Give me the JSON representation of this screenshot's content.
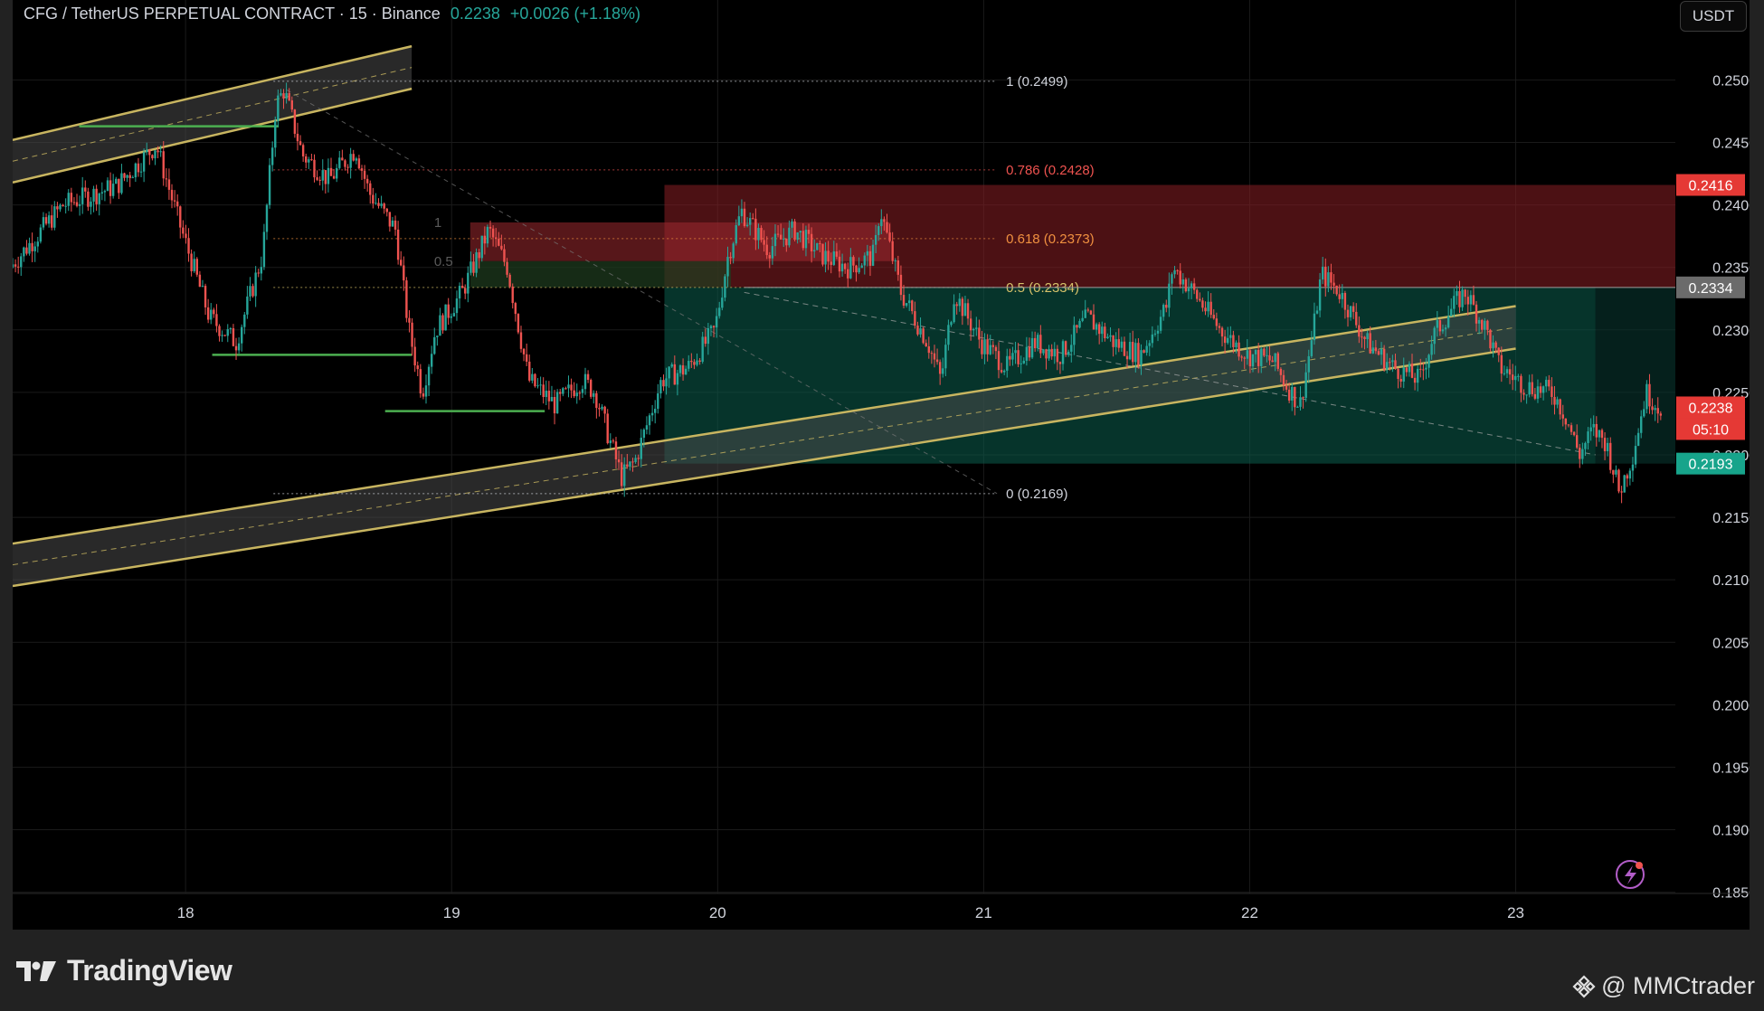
{
  "header": {
    "symbol": "CFG / TetherUS PERPETUAL CONTRACT · 15 · Binance",
    "price": "0.2238",
    "change": "+0.0026 (+1.18%)"
  },
  "currency_button": "USDT",
  "footer": {
    "brand": "TradingView",
    "watermark": "@ MMCtrader"
  },
  "colors": {
    "up": "#26a69a",
    "down": "#ef5350",
    "channel": "#c8b560",
    "fib": "#f0c060"
  },
  "chart_data": {
    "type": "candlestick",
    "title": "CFG / TetherUS PERPETUAL CONTRACT · 15 · Binance",
    "x_axis": {
      "labels": [
        "18",
        "19",
        "20",
        "21",
        "22",
        "23"
      ],
      "range": [
        17.35,
        23.6
      ]
    },
    "y_axis": {
      "range": [
        0.1849,
        0.2564
      ],
      "ticks": [
        "0.2500",
        "0.2450",
        "0.2400",
        "0.2350",
        "0.2300",
        "0.2250",
        "0.2200",
        "0.2150",
        "0.2100",
        "0.2050",
        "0.2000",
        "0.1950",
        "0.1900",
        "0.1850"
      ],
      "side": "right"
    },
    "price_path": [
      [
        17.35,
        0.235
      ],
      [
        17.55,
        0.24
      ],
      [
        17.75,
        0.2415
      ],
      [
        17.9,
        0.2448
      ],
      [
        17.98,
        0.239
      ],
      [
        18.1,
        0.231
      ],
      [
        18.2,
        0.229
      ],
      [
        18.3,
        0.236
      ],
      [
        18.35,
        0.248
      ],
      [
        18.38,
        0.2492
      ],
      [
        18.45,
        0.244
      ],
      [
        18.55,
        0.242
      ],
      [
        18.65,
        0.2445
      ],
      [
        18.7,
        0.241
      ],
      [
        18.8,
        0.238
      ],
      [
        18.85,
        0.23
      ],
      [
        18.9,
        0.225
      ],
      [
        18.95,
        0.23
      ],
      [
        19.05,
        0.233
      ],
      [
        19.15,
        0.238
      ],
      [
        19.22,
        0.235
      ],
      [
        19.3,
        0.226
      ],
      [
        19.4,
        0.224
      ],
      [
        19.5,
        0.226
      ],
      [
        19.55,
        0.225
      ],
      [
        19.6,
        0.2215
      ],
      [
        19.65,
        0.2182
      ],
      [
        19.7,
        0.2195
      ],
      [
        19.8,
        0.226
      ],
      [
        19.9,
        0.227
      ],
      [
        20.0,
        0.23
      ],
      [
        20.05,
        0.236
      ],
      [
        20.1,
        0.2395
      ],
      [
        20.2,
        0.2365
      ],
      [
        20.3,
        0.238
      ],
      [
        20.4,
        0.236
      ],
      [
        20.5,
        0.235
      ],
      [
        20.6,
        0.236
      ],
      [
        20.62,
        0.2398
      ],
      [
        20.7,
        0.233
      ],
      [
        20.8,
        0.229
      ],
      [
        20.85,
        0.226
      ],
      [
        20.9,
        0.233
      ],
      [
        21.0,
        0.229
      ],
      [
        21.1,
        0.227
      ],
      [
        21.2,
        0.229
      ],
      [
        21.3,
        0.228
      ],
      [
        21.4,
        0.231
      ],
      [
        21.5,
        0.229
      ],
      [
        21.6,
        0.228
      ],
      [
        21.7,
        0.232
      ],
      [
        21.72,
        0.235
      ],
      [
        21.8,
        0.233
      ],
      [
        21.9,
        0.23
      ],
      [
        22.0,
        0.228
      ],
      [
        22.1,
        0.2275
      ],
      [
        22.15,
        0.2255
      ],
      [
        22.2,
        0.224
      ],
      [
        22.25,
        0.23
      ],
      [
        22.28,
        0.2345
      ],
      [
        22.35,
        0.233
      ],
      [
        22.45,
        0.229
      ],
      [
        22.55,
        0.227
      ],
      [
        22.65,
        0.226
      ],
      [
        22.7,
        0.2295
      ],
      [
        22.78,
        0.232
      ],
      [
        22.82,
        0.233
      ],
      [
        22.9,
        0.23
      ],
      [
        22.95,
        0.227
      ],
      [
        23.05,
        0.2255
      ],
      [
        23.15,
        0.225
      ],
      [
        23.2,
        0.223
      ],
      [
        23.25,
        0.22
      ],
      [
        23.3,
        0.222
      ],
      [
        23.35,
        0.221
      ],
      [
        23.4,
        0.217
      ],
      [
        23.45,
        0.22
      ],
      [
        23.5,
        0.225
      ],
      [
        23.55,
        0.2238
      ]
    ],
    "fibonacci": {
      "levels": [
        {
          "label": "1 (0.2499)",
          "value": 0.2499
        },
        {
          "label": "0.786 (0.2428)",
          "value": 0.2428
        },
        {
          "label": "0.618 (0.2373)",
          "value": 0.2373
        },
        {
          "label": "0.5 (0.2334)",
          "value": 0.2334
        },
        {
          "label": "0 (0.2169)",
          "value": 0.2169
        }
      ],
      "range": [
        18.33,
        21.05
      ]
    },
    "mini_fib": {
      "labels": [
        "1",
        "0.5"
      ],
      "levels": [
        0.2386,
        0.2355
      ],
      "range": [
        19.07,
        20.65
      ]
    },
    "trade_zones": [
      {
        "kind": "stop",
        "from": 0.2334,
        "to": 0.2416,
        "range": [
          19.8,
          23.6
        ],
        "color": "#8a1f24"
      },
      {
        "kind": "target",
        "from": 0.2193,
        "to": 0.2334,
        "range": [
          19.8,
          23.3
        ],
        "color": "#0b5e4e"
      }
    ],
    "channels": [
      {
        "name": "upper-left",
        "start": [
          17.35,
          0.2435
        ],
        "end": [
          18.85,
          0.251
        ],
        "width": 0.0034
      },
      {
        "name": "lower-long",
        "start": [
          17.35,
          0.2112
        ],
        "end": [
          23.0,
          0.2302
        ],
        "width": 0.0034
      }
    ],
    "horizontal_lines": [
      {
        "y": 0.2463,
        "range": [
          17.6,
          18.35
        ]
      },
      {
        "y": 0.228,
        "range": [
          18.1,
          18.85
        ]
      },
      {
        "y": 0.2235,
        "range": [
          18.75,
          19.35
        ]
      }
    ],
    "price_badges": [
      {
        "text": "0.2416",
        "value": 0.2416,
        "color": "#e53935"
      },
      {
        "text": "0.2334",
        "value": 0.2334,
        "color": "#6b6b6b"
      },
      {
        "text": "0.2238",
        "value": 0.2238,
        "color": "#e53935"
      },
      {
        "text": "05:10",
        "value": 0.2238,
        "color": "#e53935"
      },
      {
        "text": "0.2193",
        "value": 0.2193,
        "color": "#17a48b"
      }
    ]
  }
}
